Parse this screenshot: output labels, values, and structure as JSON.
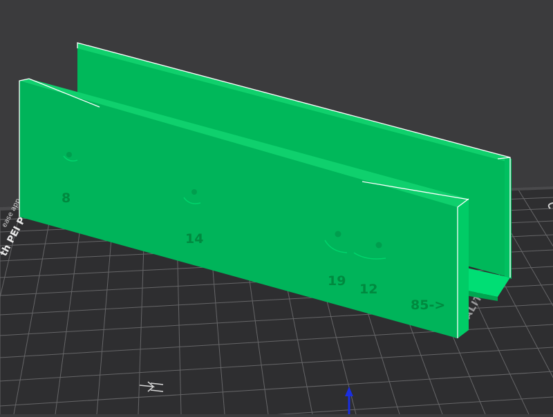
{
  "viewport": {
    "background": "#3b3b3d",
    "bed": {
      "plate_label": "th PEI Plat",
      "plate_sub_label": "ease app",
      "brand_label": "CREALITY",
      "color": "#2d2d2f",
      "grid_color": "#6a6a6c"
    }
  },
  "model": {
    "color": "#00c864",
    "labels": {
      "hole_1": "8",
      "hole_2": "14",
      "hole_3": "19",
      "hole_4": "12",
      "length": "85->"
    }
  },
  "axis": {
    "z_color": "#1a2ee0"
  },
  "icons": {
    "bed_arrow": "double-arrow-icon"
  }
}
